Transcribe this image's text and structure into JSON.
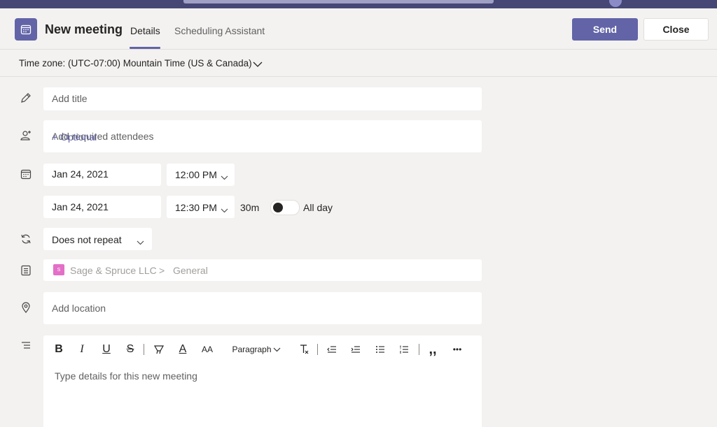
{
  "header": {
    "title": "New meeting",
    "tabs": [
      {
        "label": "Details",
        "active": true
      },
      {
        "label": "Scheduling Assistant",
        "active": false
      }
    ],
    "send_label": "Send",
    "close_label": "Close",
    "accent_color": "#6264a7"
  },
  "timezone": {
    "label": "Time zone: (UTC-07:00) Mountain Time (US & Canada)"
  },
  "form": {
    "title_placeholder": "Add title",
    "attendees_placeholder": "Add required attendees",
    "optional_label": "+ Optional",
    "start_date": "Jan 24, 2021",
    "start_time": "12:00 PM",
    "end_date": "Jan 24, 2021",
    "end_time": "12:30 PM",
    "duration": "30m",
    "all_day_label": "All day",
    "all_day_on": false,
    "repeat": "Does not repeat",
    "channel": {
      "team_initial": "S",
      "team": "Sage & Spruce LLC",
      "separator": ">",
      "channel": "General"
    },
    "location_placeholder": "Add location"
  },
  "editor": {
    "toolbar": {
      "bold": "B",
      "italic": "I",
      "underline": "U",
      "strike": "S",
      "font_color": "A",
      "font_size": "AA",
      "paragraph": "Paragraph",
      "more": "•••"
    },
    "placeholder": "Type details for this new meeting"
  },
  "icons": [
    "calendar-icon",
    "pencil-icon",
    "add-person-icon",
    "calendar-icon",
    "repeat-icon",
    "channel-icon",
    "location-icon",
    "details-icon",
    "chevron-down-icon"
  ]
}
